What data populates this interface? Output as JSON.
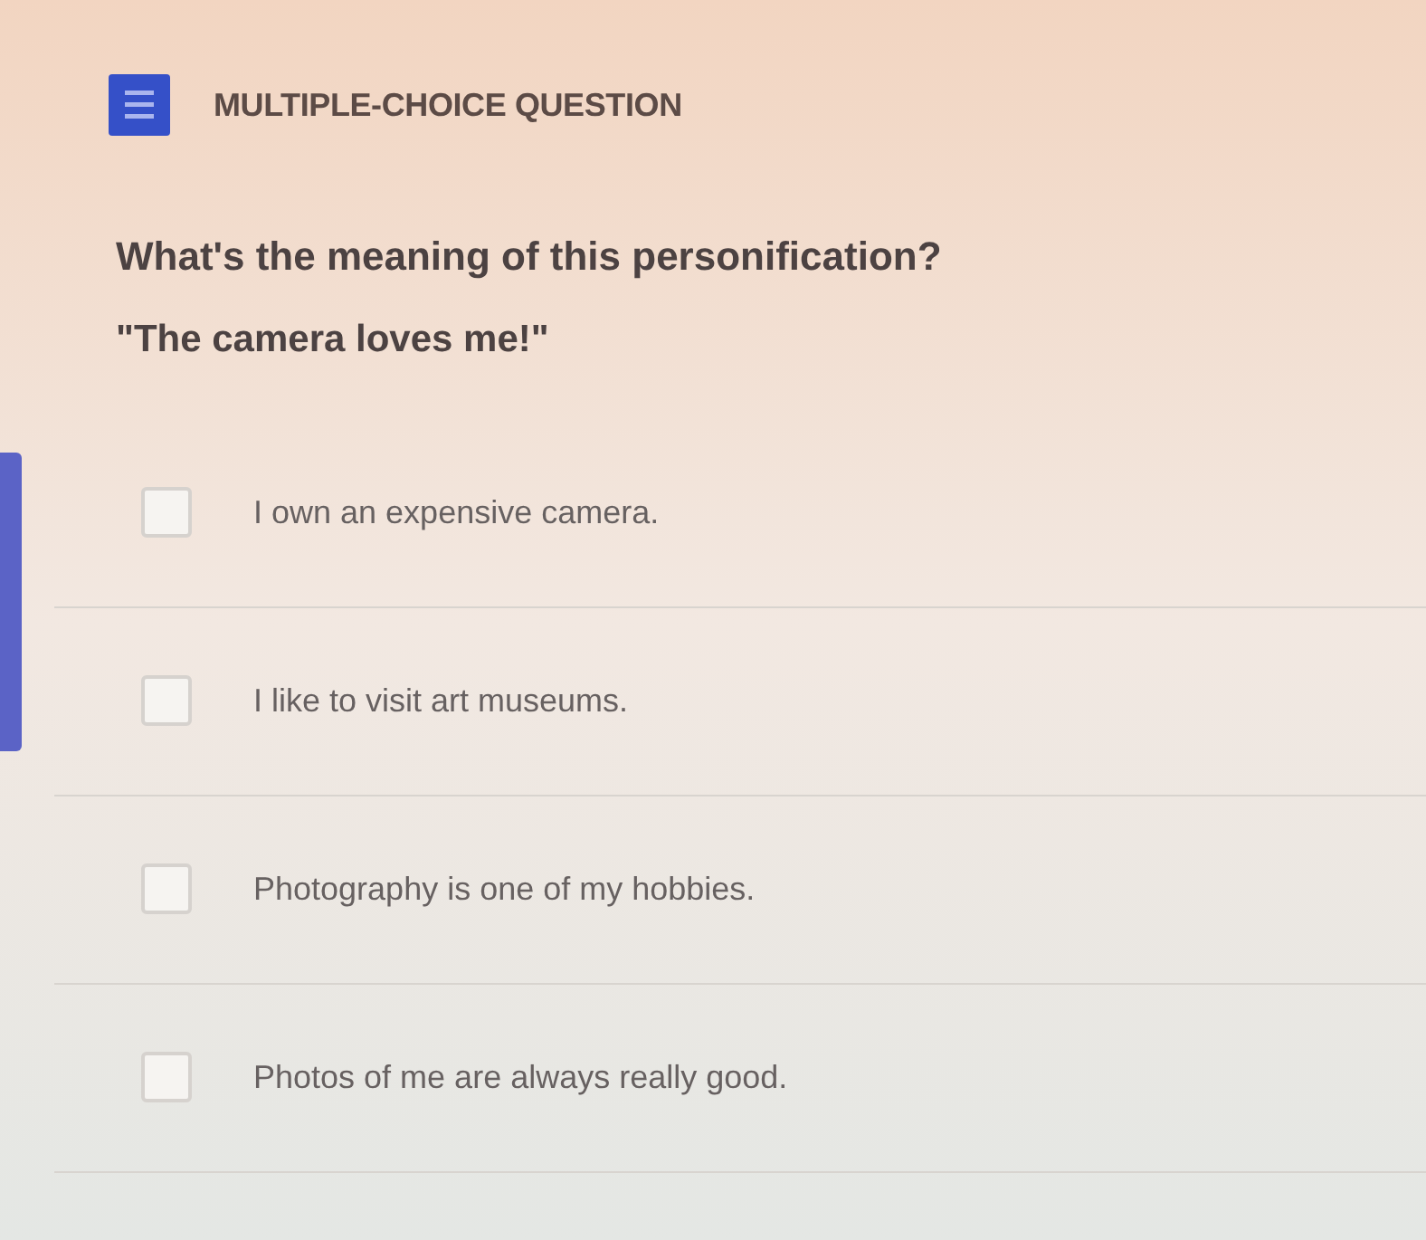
{
  "header": {
    "title": "MULTIPLE-CHOICE QUESTION"
  },
  "question": {
    "prompt": "What's the meaning of this personification?",
    "quote": "\"The camera loves me!\""
  },
  "options": [
    {
      "label": "I own an expensive camera.",
      "checked": false
    },
    {
      "label": "I like to visit art museums.",
      "checked": false
    },
    {
      "label": "Photography is one of my hobbies.",
      "checked": false
    },
    {
      "label": "Photos of me are always really good.",
      "checked": false
    }
  ]
}
